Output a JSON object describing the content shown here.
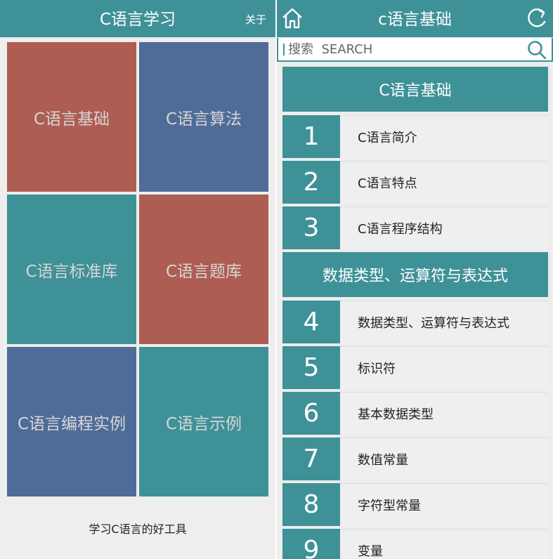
{
  "left": {
    "title": "C语言学习",
    "about_label": "关于",
    "tiles": [
      {
        "label": "C语言基础",
        "color": "#ae5d53"
      },
      {
        "label": "C语言算法",
        "color": "#4f6b98"
      },
      {
        "label": "C语言标准库",
        "color": "#3f9198"
      },
      {
        "label": "C语言题库",
        "color": "#ae5d53"
      },
      {
        "label": "C语言编程实例",
        "color": "#4f6b98"
      },
      {
        "label": "C语言示例",
        "color": "#3f9198"
      }
    ],
    "tagline": "学习C语言的好工具"
  },
  "right": {
    "title": "c语言基础",
    "home_icon": "home-icon",
    "refresh_icon": "refresh-icon",
    "search": {
      "placeholder": "搜索  SEARCH",
      "icon": "search-icon"
    },
    "sections": [
      {
        "title": "C语言基础"
      },
      {
        "title": "数据类型、运算符与表达式"
      }
    ],
    "rows": [
      {
        "num": "1",
        "label": "C语言简介"
      },
      {
        "num": "2",
        "label": "C语言特点"
      },
      {
        "num": "3",
        "label": "C语言程序结构"
      },
      {
        "num": "4",
        "label": "数据类型、运算符与表达式"
      },
      {
        "num": "5",
        "label": "标识符"
      },
      {
        "num": "6",
        "label": "基本数据类型"
      },
      {
        "num": "7",
        "label": "数值常量"
      },
      {
        "num": "8",
        "label": "字符型常量"
      },
      {
        "num": "9",
        "label": "变量"
      }
    ]
  },
  "colors": {
    "teal": "#3f9198",
    "red": "#ae5d53",
    "blue": "#4f6b98"
  }
}
